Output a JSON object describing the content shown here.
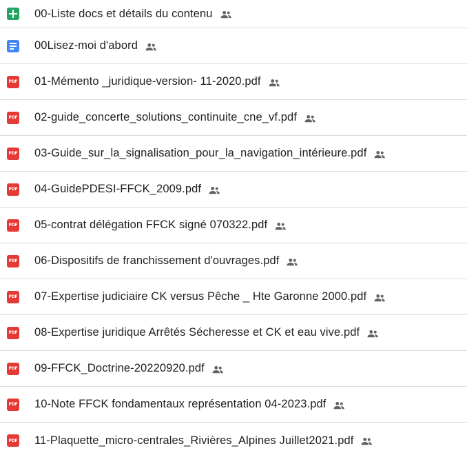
{
  "files": [
    {
      "name": "00-Liste docs et détails du contenu",
      "type": "sheet",
      "icon": "google-sheets-icon",
      "shared": true
    },
    {
      "name": "00Lisez-moi d'abord",
      "type": "doc",
      "icon": "google-docs-icon",
      "shared": true
    },
    {
      "name": "01-Mémento _juridique-version- 11-2020.pdf",
      "type": "pdf",
      "icon": "pdf-icon",
      "shared": true
    },
    {
      "name": "02-guide_concerte_solutions_continuite_cne_vf.pdf",
      "type": "pdf",
      "icon": "pdf-icon",
      "shared": true
    },
    {
      "name": "03-Guide_sur_la_signalisation_pour_la_navigation_intérieure.pdf",
      "type": "pdf",
      "icon": "pdf-icon",
      "shared": true
    },
    {
      "name": "04-GuidePDESI-FFCK_2009.pdf",
      "type": "pdf",
      "icon": "pdf-icon",
      "shared": true
    },
    {
      "name": "05-contrat délégation FFCK signé 070322.pdf",
      "type": "pdf",
      "icon": "pdf-icon",
      "shared": true
    },
    {
      "name": "06-Dispositifs de franchissement d'ouvrages.pdf",
      "type": "pdf",
      "icon": "pdf-icon",
      "shared": true
    },
    {
      "name": "07-Expertise judiciaire CK versus Pêche _ Hte Garonne 2000.pdf",
      "type": "pdf",
      "icon": "pdf-icon",
      "shared": true
    },
    {
      "name": "08-Expertise juridique Arrêtés Sécheresse et CK et eau vive.pdf",
      "type": "pdf",
      "icon": "pdf-icon",
      "shared": true
    },
    {
      "name": "09-FFCK_Doctrine-20220920.pdf",
      "type": "pdf",
      "icon": "pdf-icon",
      "shared": true
    },
    {
      "name": "10-Note FFCK fondamentaux représentation 04-2023.pdf",
      "type": "pdf",
      "icon": "pdf-icon",
      "shared": true
    },
    {
      "name": "11-Plaquette_micro-centrales_Rivières_Alpines Juillet2021.pdf",
      "type": "pdf",
      "icon": "pdf-icon",
      "shared": true
    }
  ],
  "pdf_badge_text": "PDF",
  "colors": {
    "sheet": "#23a464",
    "doc": "#4285f4",
    "pdf": "#e53935",
    "text": "#202124",
    "shared_icon": "#5f6368",
    "divider": "#dcdcdc"
  },
  "shared_icon_name": "people-icon"
}
